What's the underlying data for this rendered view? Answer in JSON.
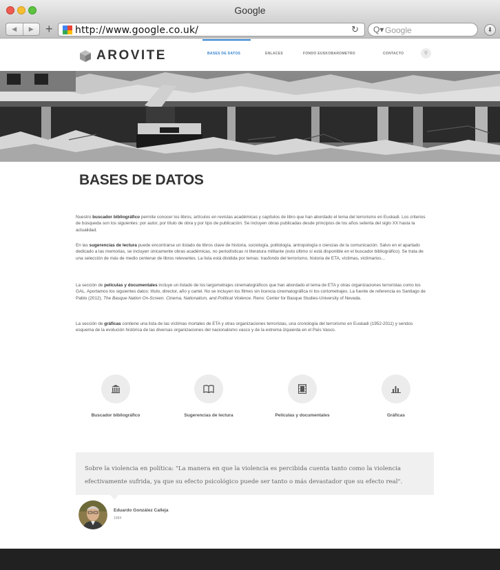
{
  "browser": {
    "window_title": "Google",
    "url": "http://www.google.co.uk/",
    "search_placeholder": "Google"
  },
  "site": {
    "logo": "AROVITE",
    "nav": [
      {
        "label": "BASES DE DATOS",
        "active": true
      },
      {
        "label": "ENLACES",
        "active": false
      },
      {
        "label": "FONDO EUSKOBAROMETRO",
        "active": false
      },
      {
        "label": "CONTACTO",
        "active": false
      }
    ],
    "accent_color": "#2d7fcf"
  },
  "main": {
    "title": "BASES DE DATOS",
    "paragraphs": {
      "p1": {
        "a": "Nuestro ",
        "bold": "buscador bibliográfico",
        "b": " permite conocer los libros, artículos en revistas académicas y capítulos de libro que han abordado el tema del terrorismo en Euskadi. Los criterios de búsqueda son los siguientes: por autor, por título de obra y por tipo de publicación. Se incluyen obras publicadas desde principios de los años setenta del siglo XX hasta la actualidad."
      },
      "p2": {
        "a": "En las ",
        "bold": "sugerencias de lectura",
        "b": " puede encontrarse un listado de libros clave de historia, sociología, politología, antropología o ciencias de la comunicación. Salvo en el apartado dedicado a las memorias, se incluyen únicamente obras académicas, no periodísticas ni literatura militante (esto último sí está disponible en el buscador bibliográfico). Se trata de una selección de más de medio centenar de libros relevantes. La lista está dividida por temas: trasfondo del terrorismo, historia de ETA, víctimas, victimarios…"
      },
      "p3": {
        "a": "La sección de ",
        "bold": "películas y documentales",
        "b": " incluye un listado de los largometrajes cinematográficos que han abordado el tema de ETA y otras organizaciones terroristas como los GAL. Aportamos los siguientes datos: título, director, año y cartel. No se incluyen los filmes sin licencia cinematográfica ni los cortometrajes. La fuente de referencia es Santiago de Pablo (2012). ",
        "italic": "The Basque Nation On-Screen. Cinema, Nationalism, and Political Violence",
        "c": ". Reno: Center for Basque Studies-University of Nevada."
      },
      "p4": {
        "a": "La sección de ",
        "bold": "gráficas",
        "b": " contiene una lista de las víctimas mortales de ETA y otras organizaciones terroristas, una cronología del terrorismo en Euskadi (1952-2011) y sendos esquema de la evolución histórica de las diversas organizaciones del nacionalismo vasco y de la extrema izquierda en el País Vasco."
      }
    }
  },
  "features": [
    {
      "label": "Buscador bibliográfico",
      "icon": "library-icon"
    },
    {
      "label": "Sugerencias de lectura",
      "icon": "book-icon"
    },
    {
      "label": "Películas y documentales",
      "icon": "film-icon"
    },
    {
      "label": "Gráficas",
      "icon": "chart-icon"
    }
  ],
  "quote": {
    "text": "Sobre la violencia en política: \"La manera en que la violencia es percibida cuenta tanto como la violencia efectivamente sufrida, ya que su efecto psicológico puede ser tanto o más devastador que su efecto real\".",
    "author": "Eduardo González Calleja",
    "year": "1994"
  }
}
